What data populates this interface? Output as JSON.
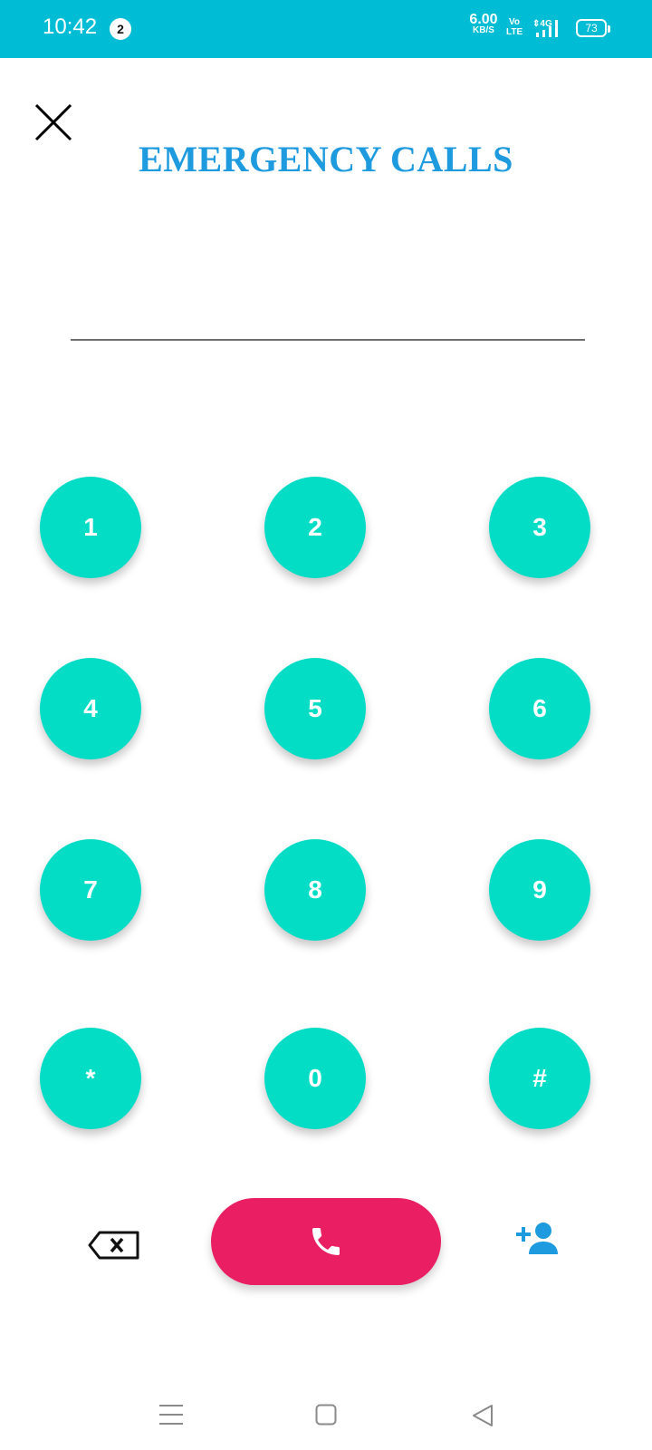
{
  "status_bar": {
    "time": "10:42",
    "notification_count": "2",
    "net_speed_value": "6.00",
    "net_speed_unit": "KB/S",
    "volte_top": "Vo",
    "volte_bottom": "LTE",
    "network_type": "4G",
    "battery_level": "73"
  },
  "header": {
    "title": "EMERGENCY CALLS",
    "close_icon": "close-icon"
  },
  "dialer": {
    "number_value": "",
    "number_placeholder": ""
  },
  "keypad": {
    "keys": [
      "1",
      "2",
      "3",
      "4",
      "5",
      "6",
      "7",
      "8",
      "9",
      "*",
      "0",
      "#"
    ]
  },
  "actions": {
    "backspace_icon": "backspace-icon",
    "call_icon": "phone-icon",
    "add_contact_icon": "add-contact-icon"
  },
  "colors": {
    "status_bar": "#00BCD4",
    "title": "#1E9ADF",
    "key": "#04DDC6",
    "call": "#E91E63",
    "add_contact": "#1E9ADF"
  }
}
